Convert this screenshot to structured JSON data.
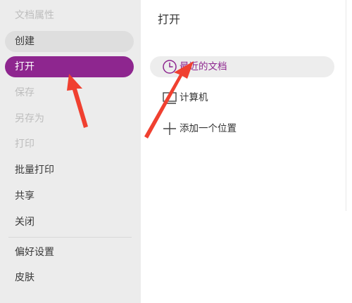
{
  "sidebar": {
    "items": [
      {
        "label": "文档属性"
      },
      {
        "label": "创建"
      },
      {
        "label": "打开"
      },
      {
        "label": "保存"
      },
      {
        "label": "另存为"
      },
      {
        "label": "打印"
      },
      {
        "label": "批量打印"
      },
      {
        "label": "共享"
      },
      {
        "label": "关闭"
      },
      {
        "label": "偏好设置"
      },
      {
        "label": "皮肤"
      }
    ]
  },
  "main": {
    "title": "打开",
    "options": [
      {
        "label": "最近的文档",
        "icon": "clock-icon"
      },
      {
        "label": "计算机",
        "icon": "computer-icon"
      },
      {
        "label": "添加一个位置",
        "icon": "plus-icon"
      }
    ]
  },
  "colors": {
    "accent": "#8e268f",
    "annotation_arrow": "#f04030"
  }
}
